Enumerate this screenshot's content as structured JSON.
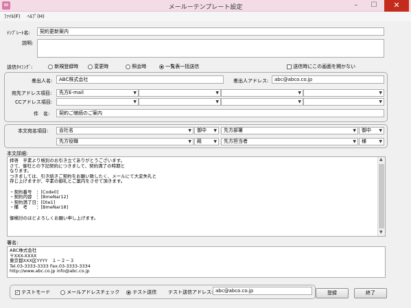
{
  "window": {
    "title": "メールーテンプレート設定",
    "minimize": "–",
    "maximize": "☐",
    "close": "✕"
  },
  "menu": {
    "file": "ﾌｧｲﾙ(F)",
    "help": "ﾍﾙﾌﾟ(H)"
  },
  "template": {
    "name_label": "ﾃﾝﾌﾟﾚｰﾄ名:",
    "name_value": "契約更新案内",
    "desc_label": "説明:",
    "desc_value": ""
  },
  "timing": {
    "label": "送信ﾀｲﾐﾝｸﾞ:",
    "options": [
      "新規登録時",
      "変更時",
      "照会時",
      "一覧表一括送信"
    ],
    "selected": 3,
    "no_screen_label": "送信時にこの画面を開かない",
    "no_screen_checked": false
  },
  "sender": {
    "name_label": "差出人名:",
    "name_value": "ABC株式会社",
    "address_label": "差出人アドレス:",
    "address_value": "abc@abco.co.jp"
  },
  "recipients": {
    "to_label": "宛先アドレス項目:",
    "to_values": [
      "先方E-mail",
      "",
      "",
      ""
    ],
    "cc_label": "CCアドレス項目:",
    "cc_values": [
      "",
      "",
      "",
      ""
    ],
    "subject_label": "件　名:",
    "subject_value": "契約ご継続のご案内"
  },
  "address_block": {
    "label": "本文宛名項目:",
    "row1": [
      "会社名",
      "御中",
      "先方部署",
      "御中"
    ],
    "row2": [
      "先方役職",
      "殿",
      "先方担当者",
      "様"
    ]
  },
  "body": {
    "label": "本文詳細:",
    "text": "拝啓　平素より格別のお引き立てありがとうございます。\nさて、御社との下記契約につきまして、契約満了の時期と\nなります。\nつきましては、引き続きご契約をお願い致したく、メールにて大変失礼と\n存じ上げますが、平素の御礼とご案内をさせて頂きます。\n\n・契約番号　：[Code0]\n・契約内容　：[BmeNar12]\n・契約満了日：[Dte1]\n・備　考　　：[BmeNar18]\n\n御検討のほどよろしくお願い申し上げます。"
  },
  "signature": {
    "label": "署名:",
    "text": "ABC株式会社\n〒XXX-XXXX\n東京都XXX区YYYY　１－２－３\nTel.03-3333-3333 Fax.03-3333-3334\nhttp://www.abc.co.jp info@abc.co.jp"
  },
  "footer": {
    "test_mode_label": "テストモード",
    "test_mode_checked": true,
    "check_address_label": "メールアドレスチェック",
    "test_send_label": "テスト送信",
    "test_address_label": "テスト送信アドレス:",
    "test_address_value": "abc@abco.co.jp",
    "register_label": "登録",
    "close_label": "終了"
  }
}
